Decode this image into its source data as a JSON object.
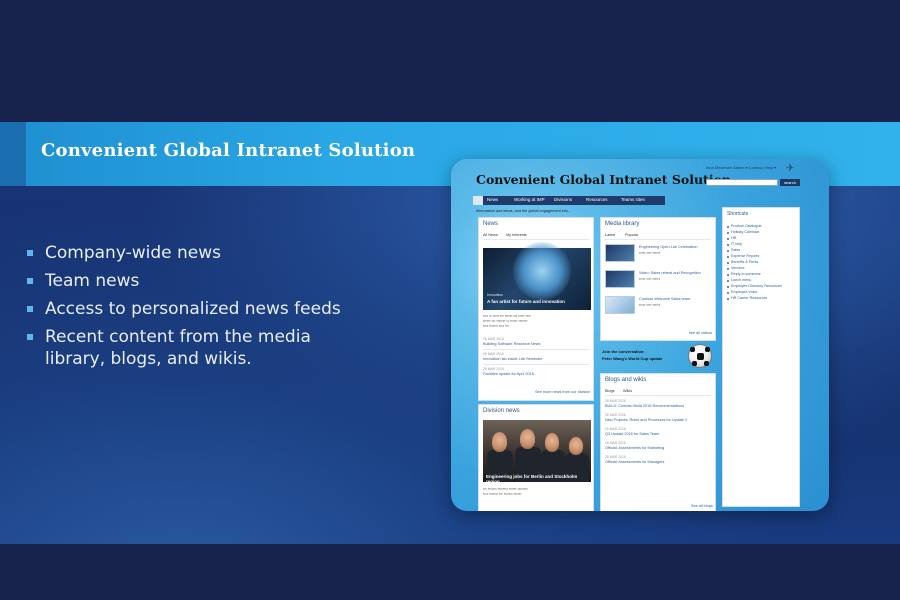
{
  "slide": {
    "title": "Convenient Global Intranet Solution",
    "bullets": [
      "Company-wide news",
      "Team news",
      "Access to personalized news feeds",
      "Recent content from the media library, blogs, and wikis."
    ]
  },
  "screenshot": {
    "site_title": "Convenient Global Intranet Solution",
    "top_links": "Irina Maximum Admin ▾   Contoso Help ▾",
    "search_button": "search",
    "nav": [
      "News",
      "Working at IMP",
      "Divisions",
      "Resources",
      "Teams sites"
    ],
    "breadcrumb": "Information and ideas, and the global engagement info...",
    "news_panel": {
      "title": "News",
      "tabs": [
        "All News",
        "My Interests"
      ],
      "hero_tag": "Innovation",
      "hero_caption": "A fan artist for future and innovation",
      "items": [
        {
          "date": "26 MAR 2016",
          "title": "Building Software Research News"
        },
        {
          "date": "26 MAR 2016",
          "title": "Innovation lab inside Lab Reminder"
        },
        {
          "date": "26 MAR 2016",
          "title": "Facilities update for April 2016"
        }
      ],
      "more": "See more news from our division"
    },
    "division_panel": {
      "title": "Division news",
      "photo_caption": "Engineering jobs for Berlin and Stockholm region"
    },
    "media_panel": {
      "title": "Media library",
      "tabs": [
        "Latest",
        "Popular"
      ],
      "items": [
        "Engineering Open Lab Celebration",
        "Video: Sales retreat and Recognition",
        "Contoso Welcome Sales team"
      ],
      "more": "see all videos"
    },
    "featured": {
      "title": "Join the conversation:",
      "subtitle": "Peter Wang's World Cup update"
    },
    "blogs_panel": {
      "title": "Blogs and wikis",
      "tabs": [
        "Blogs",
        "Wikis"
      ],
      "items": [
        {
          "date": "26 MAR 2016",
          "title": "BUILD: Contoso Build 2016 Recommendations"
        },
        {
          "date": "26 MAR 2016",
          "title": "New Projects: Rules and Processes for Update 2"
        },
        {
          "date": "26 MAR 2016",
          "title": "Q3 Update 2016 for Sales Team"
        },
        {
          "date": "26 MAR 2016",
          "title": "Official: Assessments for Marketing"
        },
        {
          "date": "26 MAR 2016",
          "title": "Official: Assessments for Managers"
        }
      ],
      "more": "See all blogs"
    },
    "shortcuts": {
      "title": "Shortcuts",
      "items": [
        "Product Catalogue",
        "Holiday Calendar",
        "HR",
        "IT help",
        "Sales",
        "Expense Reports",
        "Benefits & Perks",
        "Vendors",
        "Reply to someone",
        "Lunch menu",
        "Employee Directory Resources",
        "Employee Voice",
        "HR Career Resources"
      ]
    }
  }
}
